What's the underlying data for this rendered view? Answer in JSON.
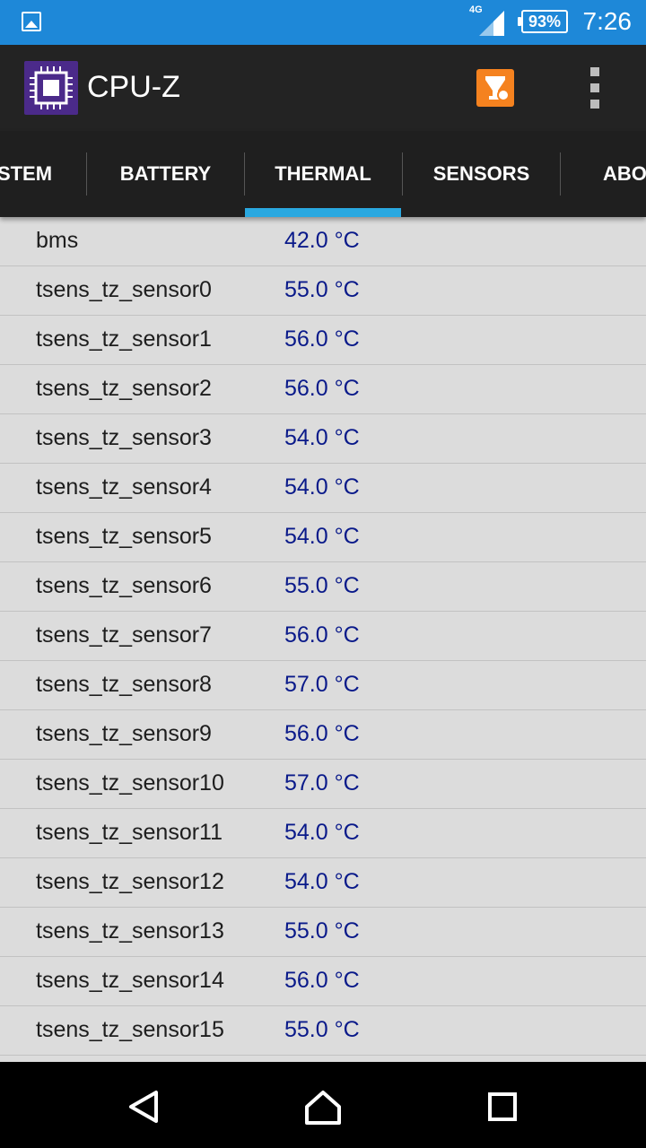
{
  "status_bar": {
    "network_label": "4G",
    "battery_percent": "93%",
    "time": "7:26"
  },
  "app_bar": {
    "title": "CPU-Z",
    "icons": [
      "cpu-chip-icon",
      "trophy-icon",
      "overflow-menu-icon"
    ],
    "accent_color": "#f5821f"
  },
  "tabs": [
    {
      "label": "STEM",
      "selected": false
    },
    {
      "label": "BATTERY",
      "selected": false
    },
    {
      "label": "THERMAL",
      "selected": true
    },
    {
      "label": "SENSORS",
      "selected": false
    },
    {
      "label": "ABO",
      "selected": false
    }
  ],
  "thermal_list": [
    {
      "name": "bms",
      "value": "42.0 °C"
    },
    {
      "name": "tsens_tz_sensor0",
      "value": "55.0 °C"
    },
    {
      "name": "tsens_tz_sensor1",
      "value": "56.0 °C"
    },
    {
      "name": "tsens_tz_sensor2",
      "value": "56.0 °C"
    },
    {
      "name": "tsens_tz_sensor3",
      "value": "54.0 °C"
    },
    {
      "name": "tsens_tz_sensor4",
      "value": "54.0 °C"
    },
    {
      "name": "tsens_tz_sensor5",
      "value": "54.0 °C"
    },
    {
      "name": "tsens_tz_sensor6",
      "value": "55.0 °C"
    },
    {
      "name": "tsens_tz_sensor7",
      "value": "56.0 °C"
    },
    {
      "name": "tsens_tz_sensor8",
      "value": "57.0 °C"
    },
    {
      "name": "tsens_tz_sensor9",
      "value": "56.0 °C"
    },
    {
      "name": "tsens_tz_sensor10",
      "value": "57.0 °C"
    },
    {
      "name": "tsens_tz_sensor11",
      "value": "54.0 °C"
    },
    {
      "name": "tsens_tz_sensor12",
      "value": "54.0 °C"
    },
    {
      "name": "tsens_tz_sensor13",
      "value": "55.0 °C"
    },
    {
      "name": "tsens_tz_sensor14",
      "value": "56.0 °C"
    },
    {
      "name": "tsens_tz_sensor15",
      "value": "55.0 °C"
    }
  ],
  "colors": {
    "status_bar": "#1e88d8",
    "tab_indicator": "#2aa8e0",
    "value_text": "#0a1a8a"
  },
  "nav_bar": {
    "icons": [
      "back-icon",
      "home-icon",
      "recents-icon"
    ]
  }
}
